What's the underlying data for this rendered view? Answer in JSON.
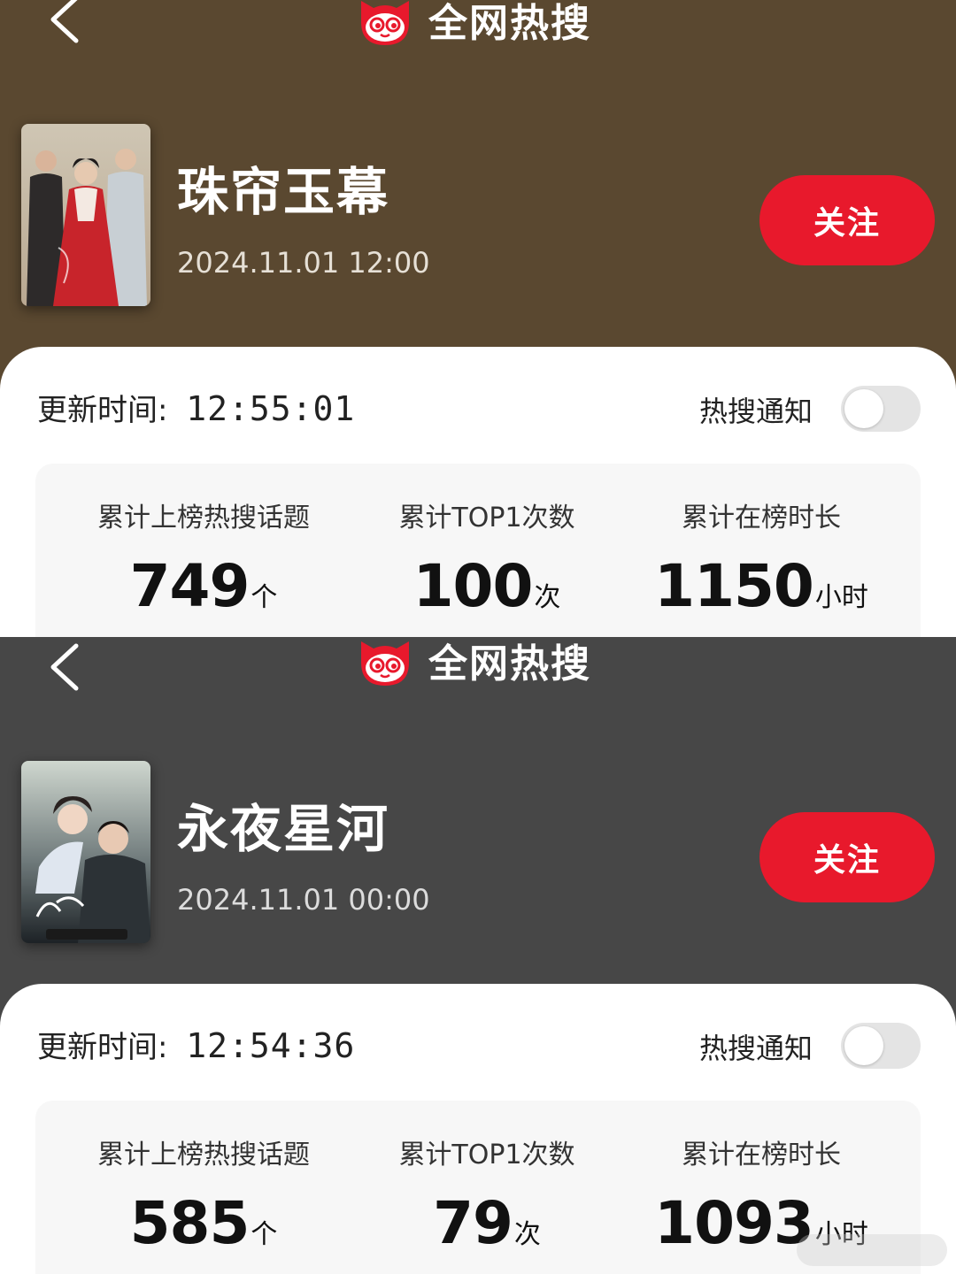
{
  "app": {
    "title": "全网热搜",
    "brand_color": "#e8192c"
  },
  "panels": [
    {
      "header_bg": "#5a4830",
      "show": {
        "name": "珠帘玉幕",
        "date": "2024.11.01 12:00",
        "poster_icon": "drama-poster-costume"
      },
      "follow_label": "关注",
      "update_label": "更新时间:",
      "update_time": "12:55:01",
      "notify_label": "热搜通知",
      "notify_enabled": false,
      "stats": [
        {
          "label": "累计上榜热搜话题",
          "value": "749",
          "unit": "个"
        },
        {
          "label": "累计TOP1次数",
          "value": "100",
          "unit": "次"
        },
        {
          "label": "累计在榜时长",
          "value": "1150",
          "unit": "小时"
        }
      ]
    },
    {
      "header_bg": "#474747",
      "show": {
        "name": "永夜星河",
        "date": "2024.11.01 00:00",
        "poster_icon": "drama-poster-couple"
      },
      "follow_label": "关注",
      "update_label": "更新时间:",
      "update_time": "12:54:36",
      "notify_label": "热搜通知",
      "notify_enabled": false,
      "stats": [
        {
          "label": "累计上榜热搜话题",
          "value": "585",
          "unit": "个"
        },
        {
          "label": "累计TOP1次数",
          "value": "79",
          "unit": "次"
        },
        {
          "label": "累计在榜时长",
          "value": "1093",
          "unit": "小时"
        }
      ]
    }
  ]
}
